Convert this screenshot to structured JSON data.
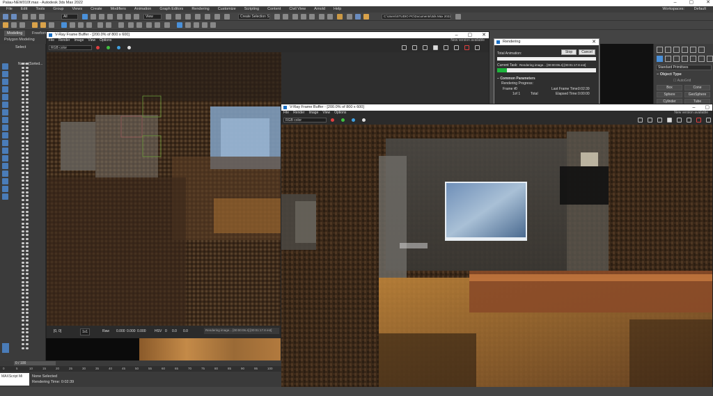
{
  "app": {
    "title": "Palau-NEW010f.max - Autodesk 3ds Max 2022",
    "workspace_label": "Workspaces:",
    "workspace_value": "Default"
  },
  "menu": [
    "File",
    "Edit",
    "Tools",
    "Group",
    "Views",
    "Create",
    "Modifiers",
    "Animation",
    "Graph Editors",
    "Rendering",
    "Customize",
    "Scripting",
    "Content",
    "Civil View",
    "Arnold",
    "Help"
  ],
  "toolbar": {
    "selection_filter": "All",
    "view_dropdown": "View",
    "selection_set": "Create Selection Se",
    "project_path": "C:\\Users\\STUDIO PC\\Documents\\3ds Max 2022"
  },
  "ribbon": {
    "tabs": [
      "Modeling",
      "Freeform"
    ],
    "sub": "Polygon Modeling"
  },
  "scene_explorer": {
    "header": "Select",
    "column": "Name (Sorted..."
  },
  "vfb_back": {
    "title": "V-Ray Frame Buffer - [200.0% of 800 x 600]",
    "menu": [
      "File",
      "Render",
      "Image",
      "View",
      "Options"
    ],
    "new_version": "New version available",
    "channel": "RGB color",
    "status_coords": "[0, 0]",
    "zoom": "1x1",
    "raw_label": "Raw",
    "raw_vals": [
      "0.000",
      "0.000",
      "0.000"
    ],
    "hsv_label": "HSV",
    "hsv_vals": [
      "0",
      "0.0",
      "0.0"
    ],
    "status_msg": "Rendering image... [00:00:06.4] [00:01:17.8 est]"
  },
  "vfb_front": {
    "title": "V-Ray Frame Buffer - [200.0% of 800 x 600]",
    "menu": [
      "File",
      "Render",
      "Image",
      "View",
      "Options"
    ],
    "new_version": "New version available",
    "channel": "RGB color"
  },
  "rendering_dialog": {
    "title": "Rendering",
    "total_animation": "Total Animation:",
    "stop_label": "Stop",
    "cancel_label": "Cancel",
    "current_task_label": "Current Task:",
    "current_task": "Rendering image... [00:00:06.4] [00:01:17.8 est]",
    "progress": 0.1,
    "section": "Common Parameters",
    "rendering_progress": "Rendering Progress:",
    "frame_label": "Frame #",
    "frame": "0",
    "of_label": "1of 1",
    "total_label": "Total",
    "last_frame_time_label": "Last Frame Time:",
    "last_frame_time": "0:02:39",
    "elapsed_label": "Elapsed Time:",
    "elapsed": "0:00:00"
  },
  "command_panel": {
    "category": "Standard Primitives",
    "section": "Object Type",
    "autogrid": "AutoGrid",
    "buttons": [
      "Box",
      "Cone",
      "Sphere",
      "GeoSphere",
      "Cylinder",
      "Tube"
    ]
  },
  "timeline": {
    "frame_counter": "0 / 100",
    "ticks": [
      "0",
      "5",
      "10",
      "15",
      "20",
      "25",
      "30",
      "35",
      "40",
      "45",
      "50",
      "55",
      "60",
      "65",
      "70",
      "75",
      "80",
      "85",
      "90",
      "95",
      "100"
    ],
    "status": "None Selected",
    "render_time": "Rendering Time: 0:02:39",
    "maxscript": "MAXScript Mi"
  }
}
